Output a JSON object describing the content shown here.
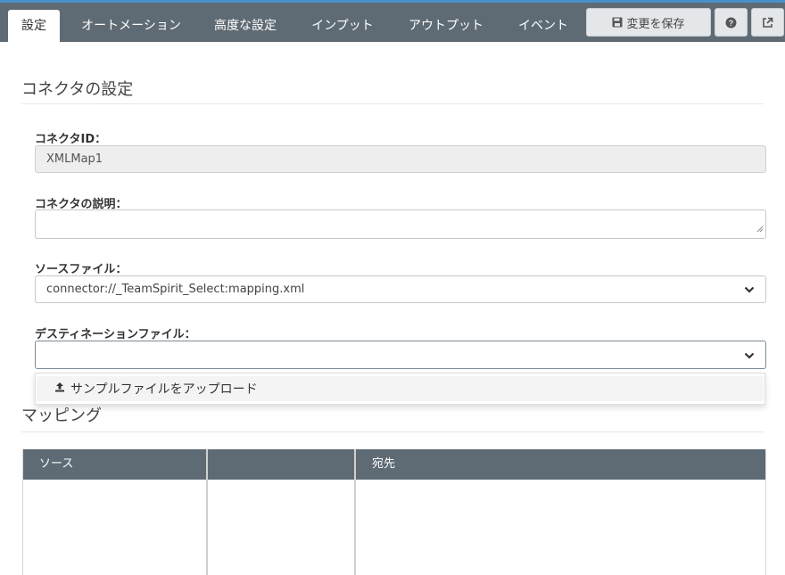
{
  "tabs": [
    {
      "label": "設定",
      "active": true
    },
    {
      "label": "オートメーション"
    },
    {
      "label": "高度な設定"
    },
    {
      "label": "インプット"
    },
    {
      "label": "アウトプット"
    },
    {
      "label": "イベント"
    }
  ],
  "toolbar": {
    "save_label": "変更を保存",
    "save_icon": "floppy-disk-icon",
    "help_icon": "question-circle-icon",
    "external_icon": "external-link-icon"
  },
  "connector_section": {
    "title": "コネクタの設定",
    "id_label": "コネクタID：",
    "id_value": "XMLMap1",
    "description_label": "コネクタの説明：",
    "description_value": "",
    "source_label": "ソースファイル：",
    "source_value": "connector://_TeamSpirit_Select:mapping.xml",
    "destination_label": "デスティネーションファイル：",
    "destination_value": "",
    "dropdown_option": "サンプルファイルをアップロード"
  },
  "mapping": {
    "title": "マッピング",
    "columns": [
      "ソース",
      "",
      "宛先"
    ]
  },
  "colors": {
    "tabbar": "#5f6b74",
    "accent_line": "#4a90c8",
    "table_header": "#5f6b74"
  }
}
